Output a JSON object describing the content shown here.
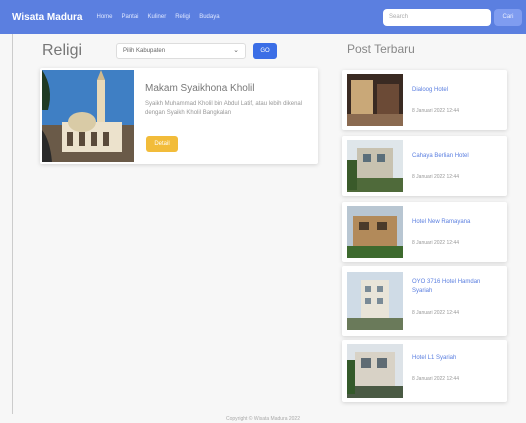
{
  "nav": {
    "brand": "Wisata Madura",
    "links": [
      "Home",
      "Pantai",
      "Kuliner",
      "Religi",
      "Budaya"
    ]
  },
  "search": {
    "placeholder": "Search",
    "button_label": "Cari"
  },
  "main": {
    "section_title": "Religi",
    "filter": {
      "selected": "Pilih Kabupaten",
      "go_label": "GO"
    },
    "cards": [
      {
        "title": "Makam Syaikhona Kholil",
        "description": "Syaikh Muhammad Kholil bin Abdul Latif, atau lebih dikenal dengan Syaikh Kholil Bangkalan",
        "button_label": "Detail"
      }
    ]
  },
  "sidebar": {
    "title": "Post Terbaru",
    "posts": [
      {
        "title": "Dialoog Hotel",
        "date": "8 Januari 2022 12:44"
      },
      {
        "title": "Cahaya Berlian Hotel",
        "date": "8 Januari 2022 12:44"
      },
      {
        "title": "Hotel New Ramayana",
        "date": "8 Januari 2022 12:44"
      },
      {
        "title": "OYO 3716 Hotel Hamdan Syariah",
        "date": "8 Januari 2022 12:44"
      },
      {
        "title": "Hotel L1 Syariah",
        "date": "8 Januari 2022 12:44"
      }
    ]
  },
  "footer": {
    "text": "Copyright © Wisata Madura 2022"
  },
  "colors": {
    "navbar": "#5b7fe0",
    "go_button": "#3b6ee6",
    "detail_button": "#f2bc3a",
    "link": "#5b7fe0"
  }
}
